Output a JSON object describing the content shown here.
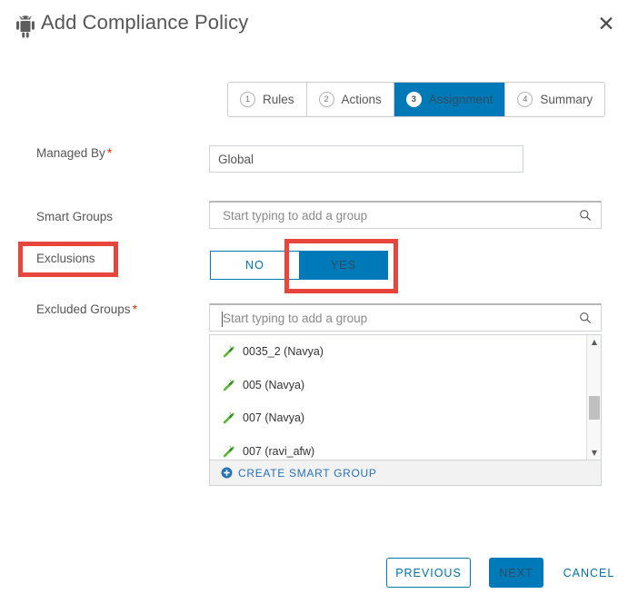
{
  "header": {
    "title": "Add Compliance Policy",
    "icon": "android-icon",
    "close_icon": "✕"
  },
  "stepper": {
    "steps": [
      {
        "num": "1",
        "label": "Rules",
        "active": false
      },
      {
        "num": "2",
        "label": "Actions",
        "active": false
      },
      {
        "num": "3",
        "label": "Assignment",
        "active": true
      },
      {
        "num": "4",
        "label": "Summary",
        "active": false
      }
    ]
  },
  "form": {
    "managed_by": {
      "label": "Managed By",
      "required": "*",
      "value": "Global"
    },
    "smart_groups": {
      "label": "Smart Groups",
      "placeholder": "Start typing to add a group",
      "value": ""
    },
    "exclusions": {
      "label": "Exclusions",
      "options": [
        {
          "label": "NO",
          "selected": false
        },
        {
          "label": "YES",
          "selected": true
        }
      ]
    },
    "excluded_groups": {
      "label": "Excluded Groups",
      "required": "*",
      "placeholder": "Start typing to add a group",
      "value": ""
    }
  },
  "dropdown": {
    "items": [
      {
        "label": "0035_2 (Navya)",
        "icon": "smart-group-wand-icon"
      },
      {
        "label": "005 (Navya)",
        "icon": "smart-group-wand-icon"
      },
      {
        "label": "007 (Navya)",
        "icon": "smart-group-wand-icon"
      },
      {
        "label": "007 (ravi_afw)",
        "icon": "smart-group-wand-icon"
      }
    ],
    "footer": {
      "label": "CREATE SMART GROUP",
      "icon": "plus-circle-icon"
    },
    "scrollbar": {
      "up_arrow": "▲",
      "down_arrow": "▼"
    }
  },
  "footer": {
    "previous": "PREVIOUS",
    "next": "NEXT",
    "cancel": "CANCEL"
  },
  "colors": {
    "accent_blue": "#0079b8",
    "link_blue": "#0072a3",
    "annotation_red": "#e8453c",
    "required_red": "#e62700",
    "wand_green": "#61a944"
  }
}
